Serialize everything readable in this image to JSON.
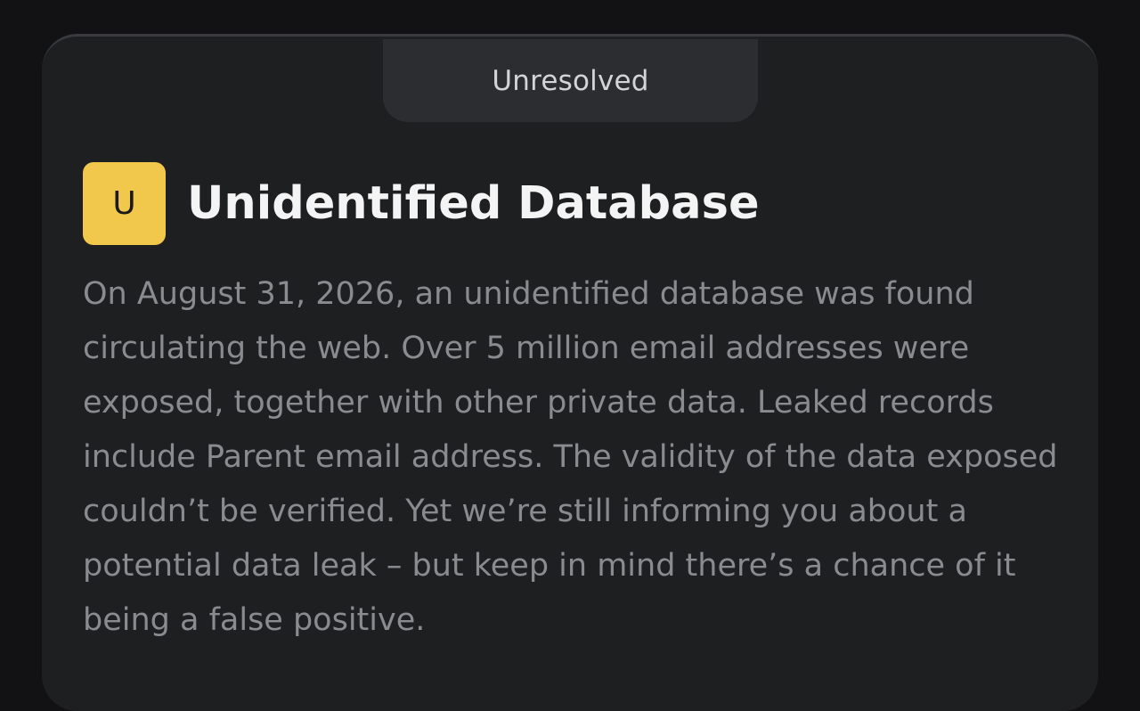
{
  "breach": {
    "status": "Unresolved",
    "avatar_letter": "U",
    "avatar_color": "#f1c84b",
    "title": "Unidentified Database",
    "description": "On August 31, 2026, an unidentified database was found circulating the web. Over 5 million email addresses were exposed, together with other private data. Leaked records include Parent email address. The validity of the data exposed couldn’t be verified. Yet we’re still informing you about a potential data leak – but keep in mind there’s a chance of it being a false positive."
  }
}
